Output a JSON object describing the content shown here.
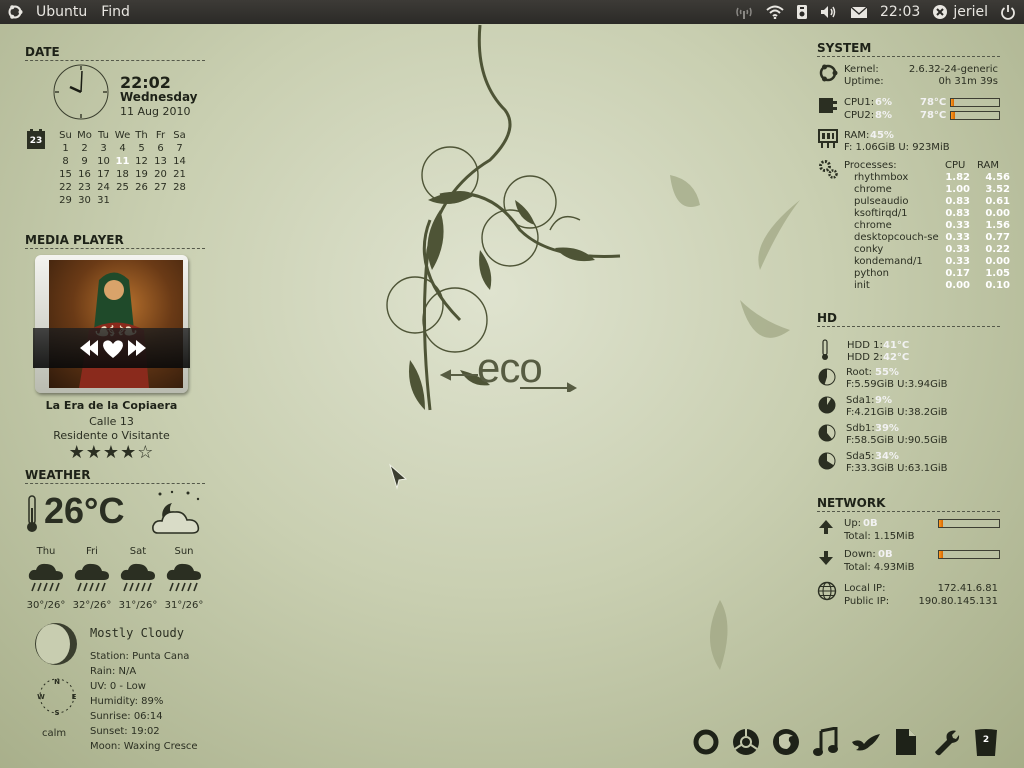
{
  "panel": {
    "menu": [
      "Ubuntu",
      "Find"
    ],
    "time": "22:03",
    "user": "jeriel"
  },
  "date": {
    "header": "DATE",
    "time": "22:02",
    "weekday": "Wednesday",
    "date": "11 Aug 2010",
    "cal_icon_num": "23",
    "cal_head": [
      "Su",
      "Mo",
      "Tu",
      "We",
      "Th",
      "Fr",
      "Sa"
    ],
    "cal_rows": [
      [
        "",
        "1",
        "2",
        "3",
        "4",
        "5",
        "6",
        "7"
      ],
      [
        "",
        "8",
        "9",
        "10",
        "11",
        "12",
        "13",
        "14"
      ],
      [
        "",
        "15",
        "16",
        "17",
        "18",
        "19",
        "20",
        "21"
      ],
      [
        "",
        "22",
        "23",
        "24",
        "25",
        "26",
        "27",
        "28"
      ],
      [
        "",
        "29",
        "30",
        "31",
        "",
        "",
        "",
        ""
      ]
    ],
    "cal_today": "11"
  },
  "media": {
    "header": "MEDIA PLAYER",
    "title": "La Era de la Copiaera",
    "artist": "Calle 13",
    "album": "Residente o Visitante",
    "rating": 4,
    "stars": "★★★★☆"
  },
  "weather": {
    "header": "WEATHER",
    "temp": "26°C",
    "forecast": [
      {
        "day": "Thu",
        "range": "30°/26°"
      },
      {
        "day": "Fri",
        "range": "32°/26°"
      },
      {
        "day": "Sat",
        "range": "31°/26°"
      },
      {
        "day": "Sun",
        "range": "31°/26°"
      }
    ],
    "condition": "Mostly Cloudy",
    "station": "Station: Punta Cana",
    "rain": "Rain: N/A",
    "uv": "UV: 0 - Low",
    "humidity": "Humidity: 89%",
    "sunrise": "Sunrise: 06:14",
    "sunset": "Sunset: 19:02",
    "moon": "Moon: Waxing Cresce",
    "wind": "calm",
    "compass": [
      "N",
      "E",
      "S",
      "W"
    ]
  },
  "wallpaper": {
    "logo": "eco"
  },
  "system": {
    "header": "SYSTEM",
    "kernel_label": "Kernel:",
    "kernel": "2.6.32-24-generic",
    "uptime_label": "Uptime:",
    "uptime": "0h 31m 39s",
    "cpu1_label": "CPU1:",
    "cpu1": "6%",
    "cpu1_temp": "78°C",
    "cpu1_pct": 6,
    "cpu2_label": "CPU2:",
    "cpu2": "8%",
    "cpu2_temp": "78°C",
    "cpu2_pct": 8,
    "ram_label": "RAM:",
    "ram": "45%",
    "ram_detail": "F: 1.06GiB U: 923MiB",
    "proc_label": "Processes:",
    "proc_cpu_head": "CPU",
    "proc_ram_head": "RAM",
    "processes": [
      {
        "name": "rhythmbox",
        "cpu": "1.82",
        "ram": "4.56"
      },
      {
        "name": "chrome",
        "cpu": "1.00",
        "ram": "3.52"
      },
      {
        "name": "pulseaudio",
        "cpu": "0.83",
        "ram": "0.61"
      },
      {
        "name": "ksoftirqd/1",
        "cpu": "0.83",
        "ram": "0.00"
      },
      {
        "name": "chrome",
        "cpu": "0.33",
        "ram": "1.56"
      },
      {
        "name": "desktopcouch-se",
        "cpu": "0.33",
        "ram": "0.77"
      },
      {
        "name": "conky",
        "cpu": "0.33",
        "ram": "0.22"
      },
      {
        "name": "kondemand/1",
        "cpu": "0.33",
        "ram": "0.00"
      },
      {
        "name": "python",
        "cpu": "0.17",
        "ram": "1.05"
      },
      {
        "name": "init",
        "cpu": "0.00",
        "ram": "0.10"
      }
    ]
  },
  "hd": {
    "header": "HD",
    "hdd1_label": "HDD 1:",
    "hdd1": "41°C",
    "hdd2_label": "HDD 2:",
    "hdd2": "42°C",
    "disks": [
      {
        "label": "Root:",
        "pct": "55%",
        "pct_num": 55,
        "detail": "F:5.59GiB U:3.94GiB"
      },
      {
        "label": "Sda1:",
        "pct": "9%",
        "pct_num": 9,
        "detail": "F:4.21GiB U:38.2GiB"
      },
      {
        "label": "Sdb1:",
        "pct": "39%",
        "pct_num": 39,
        "detail": "F:58.5GiB U:90.5GiB"
      },
      {
        "label": "Sda5:",
        "pct": "34%",
        "pct_num": 34,
        "detail": "F:33.3GiB U:63.1GiB"
      }
    ]
  },
  "network": {
    "header": "NETWORK",
    "up_label": "Up:",
    "up": "0B",
    "up_total": "Total: 1.15MiB",
    "down_label": "Down:",
    "down": "0B",
    "down_total": "Total: 4.93MiB",
    "local_label": "Local IP:",
    "local_ip": "172.41.6.81",
    "public_label": "Public IP:",
    "public_ip": "190.80.145.131"
  },
  "dock": {
    "icons": [
      "circle-icon",
      "chrome-icon",
      "firefox-icon",
      "music-icon",
      "bird-icon",
      "document-icon",
      "wrench-icon",
      "trash-icon"
    ],
    "trash_badge": "2"
  }
}
